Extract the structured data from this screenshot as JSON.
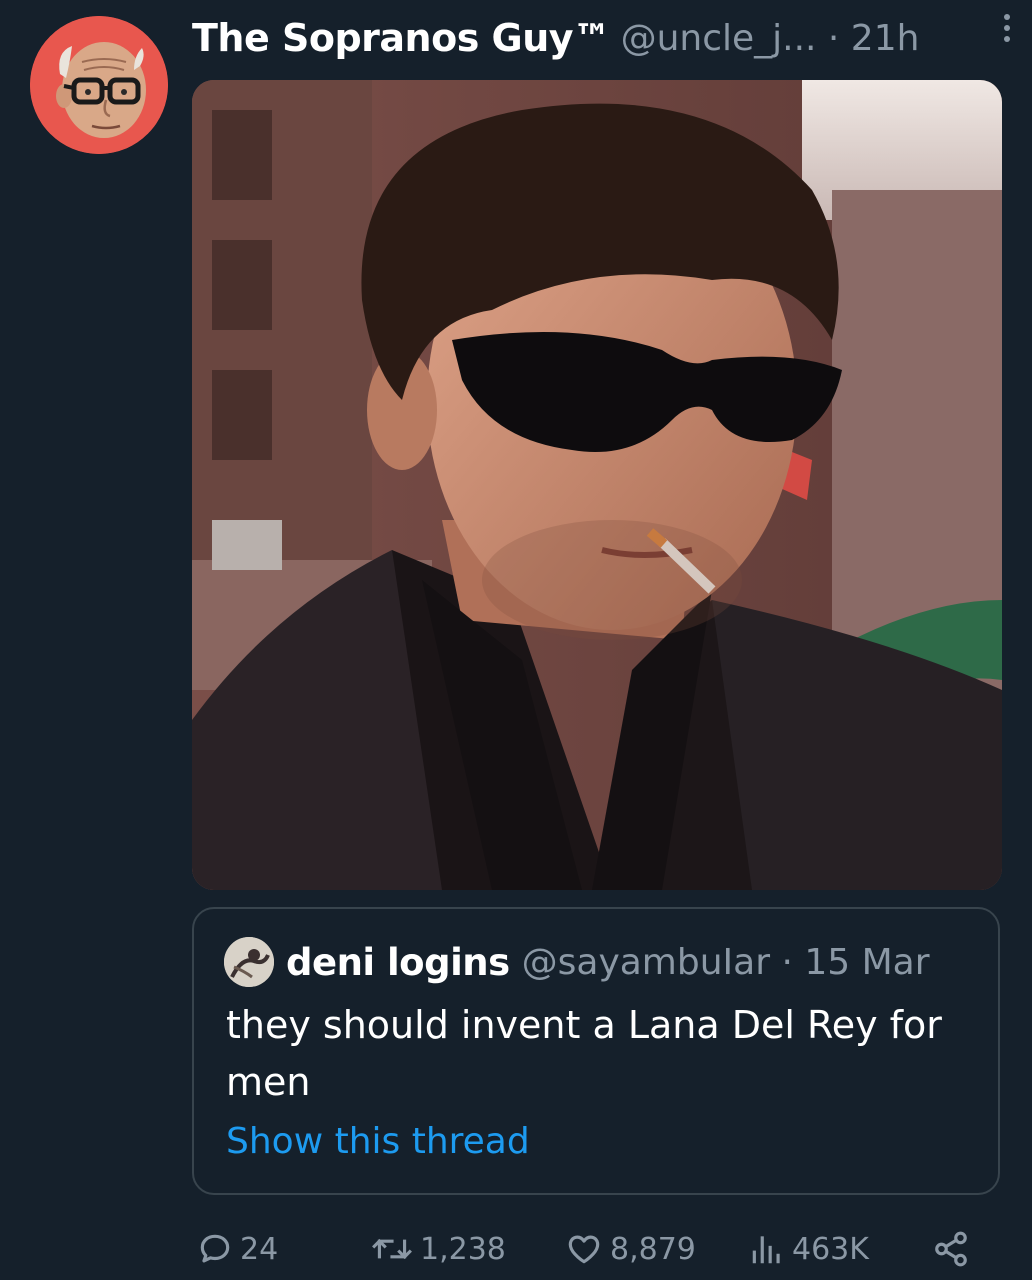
{
  "tweet": {
    "display_name": "The Sopranos Guy™",
    "handle_and_time": "@uncle_j... · 21h",
    "avatar_icon": "old-man-cartoon-avatar",
    "media_description": "photo"
  },
  "quote": {
    "display_name": "deni logins",
    "handle_and_time": "@sayambuIar · 15 Mar",
    "text": "they should invent a Lana Del Rey for men",
    "link_label": "Show this thread"
  },
  "actions": {
    "replies": "24",
    "retweets": "1,238",
    "likes": "8,879",
    "views": "463K"
  },
  "colors": {
    "background": "#15202b",
    "secondary_text": "#8b98a5",
    "link": "#1d9bf0",
    "border": "#38444d",
    "avatar_bg": "#e8574e"
  }
}
